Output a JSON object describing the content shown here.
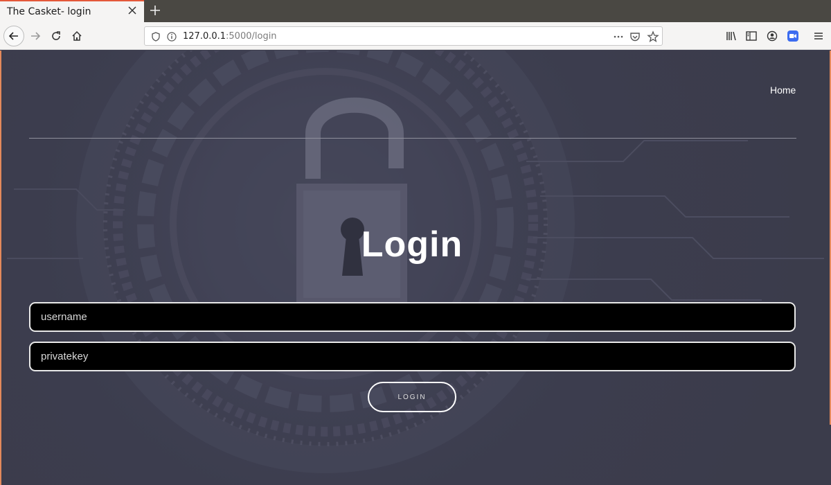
{
  "browser": {
    "tab_title": "The Casket- login",
    "url_host": "127.0.0.1",
    "url_rest": ":5000/login"
  },
  "nav": {
    "home_label": "Home"
  },
  "main": {
    "title": "Login",
    "username_placeholder": "username",
    "privatekey_placeholder": "privatekey",
    "login_label": "LOGIN"
  },
  "colors": {
    "accent": "#e4583a",
    "page_bg": "#3b3c4d",
    "field_bg": "#000000"
  }
}
